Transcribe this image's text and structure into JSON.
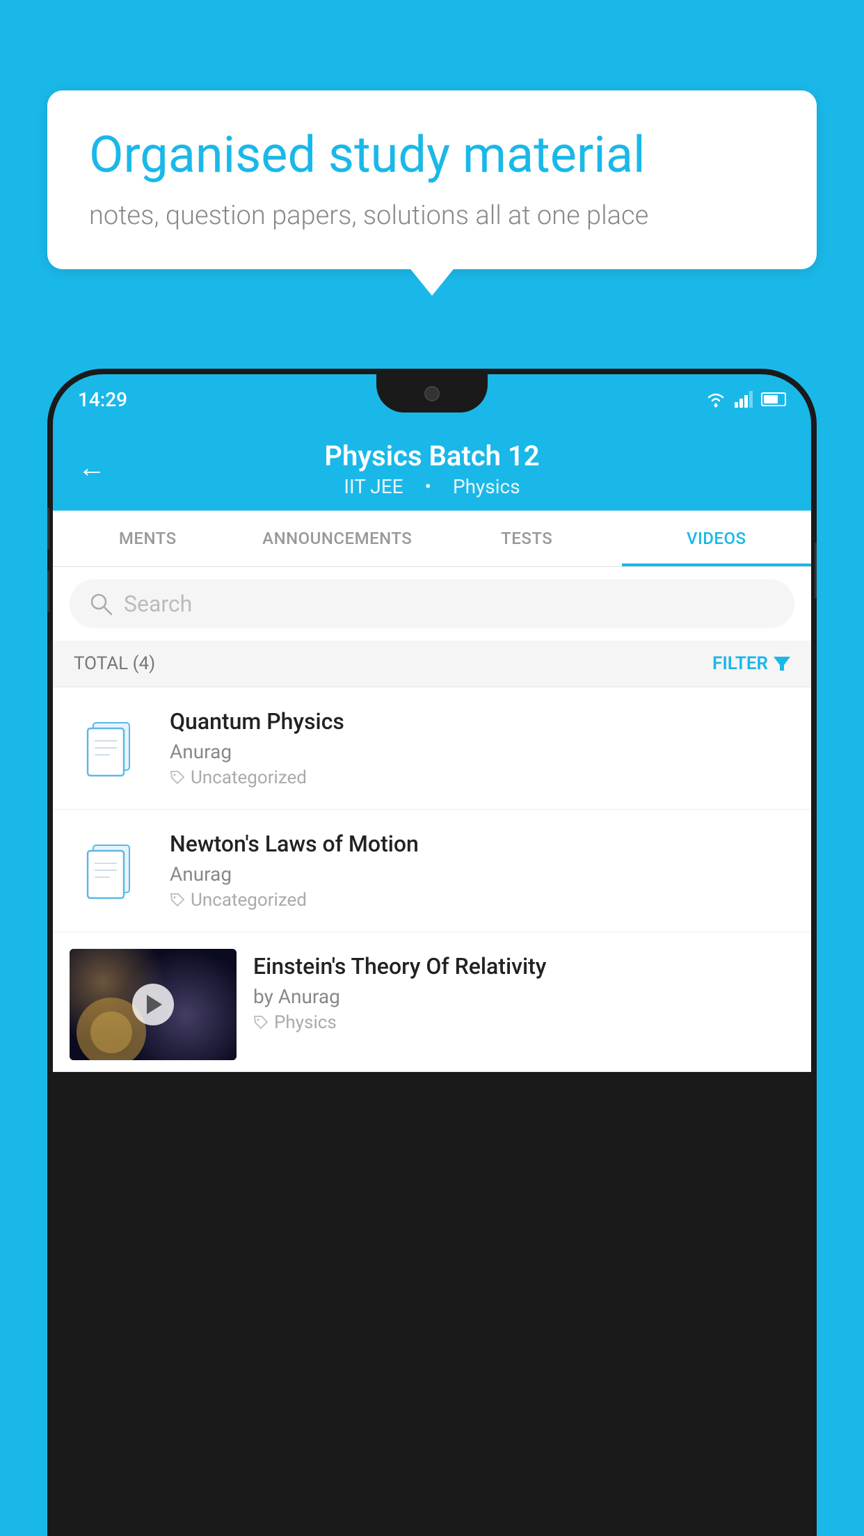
{
  "page": {
    "background_color": "#1ab8e8"
  },
  "speech_bubble": {
    "heading": "Organised study material",
    "subtext": "notes, question papers, solutions all at one place"
  },
  "status_bar": {
    "time": "14:29"
  },
  "app_header": {
    "title": "Physics Batch 12",
    "subtitle_part1": "IIT JEE",
    "subtitle_part2": "Physics",
    "back_label": "←"
  },
  "tabs": [
    {
      "label": "MENTS",
      "active": false
    },
    {
      "label": "ANNOUNCEMENTS",
      "active": false
    },
    {
      "label": "TESTS",
      "active": false
    },
    {
      "label": "VIDEOS",
      "active": true
    }
  ],
  "search": {
    "placeholder": "Search"
  },
  "filter_bar": {
    "total_label": "TOTAL (4)",
    "filter_label": "FILTER"
  },
  "videos": [
    {
      "title": "Quantum Physics",
      "author": "Anurag",
      "tag": "Uncategorized",
      "has_thumbnail": false
    },
    {
      "title": "Newton's Laws of Motion",
      "author": "Anurag",
      "tag": "Uncategorized",
      "has_thumbnail": false
    },
    {
      "title": "Einstein's Theory Of Relativity",
      "author": "by Anurag",
      "tag": "Physics",
      "has_thumbnail": true
    }
  ]
}
